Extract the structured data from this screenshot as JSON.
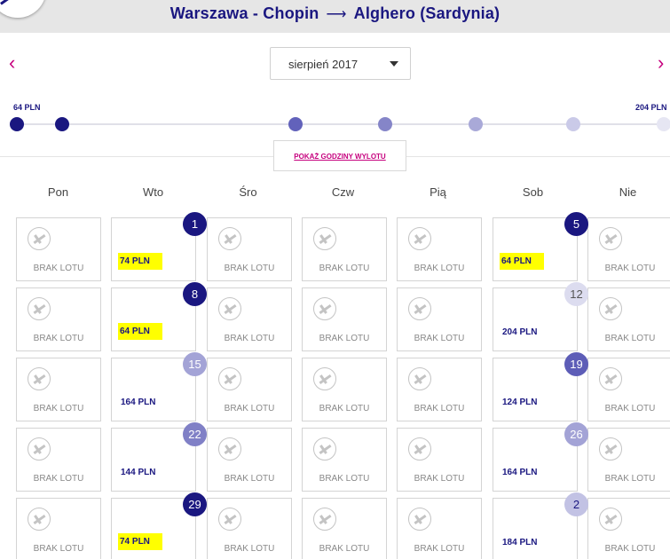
{
  "header": {
    "origin": "Warszawa - Chopin",
    "arrow": "⟶",
    "destination": "Alghero (Sardynia)"
  },
  "nav": {
    "prev": "‹",
    "next": "›"
  },
  "month_select": {
    "value": "sierpień 2017"
  },
  "price_slider": {
    "min_label": "64 PLN",
    "max_label": "204 PLN",
    "dot_colors": [
      "#1a1780",
      "#1a1780",
      "#6262bb",
      "#8585c8",
      "#a9a9d8",
      "#cacae8",
      "#e6e6f3"
    ]
  },
  "show_times_label": "POKAŻ GODZINY WYLOTU",
  "weekdays": [
    "Pon",
    "Wto",
    "Śro",
    "Czw",
    "Pią",
    "Sob",
    "Nie"
  ],
  "no_flight_label": "BRAK LOTU",
  "calendar": [
    [
      {
        "flight": false
      },
      {
        "flight": true,
        "day": "1",
        "price": "74 PLN",
        "highlight": true,
        "badge_color": "#1a1780"
      },
      {
        "flight": false
      },
      {
        "flight": false
      },
      {
        "flight": false
      },
      {
        "flight": true,
        "day": "5",
        "price": "64 PLN",
        "highlight": true,
        "badge_color": "#1a1780"
      },
      {
        "flight": false
      }
    ],
    [
      {
        "flight": false
      },
      {
        "flight": true,
        "day": "8",
        "price": "64 PLN",
        "highlight": true,
        "badge_color": "#1a1780"
      },
      {
        "flight": false
      },
      {
        "flight": false
      },
      {
        "flight": false
      },
      {
        "flight": true,
        "day": "12",
        "price": "204 PLN",
        "highlight": false,
        "badge_color": "#dcdcef",
        "badge_text_color": "#555"
      },
      {
        "flight": false
      }
    ],
    [
      {
        "flight": false
      },
      {
        "flight": true,
        "day": "15",
        "price": "164 PLN",
        "highlight": false,
        "badge_color": "#a3a3d6"
      },
      {
        "flight": false
      },
      {
        "flight": false
      },
      {
        "flight": false
      },
      {
        "flight": true,
        "day": "19",
        "price": "124 PLN",
        "highlight": false,
        "badge_color": "#5d5db7"
      },
      {
        "flight": false
      }
    ],
    [
      {
        "flight": false
      },
      {
        "flight": true,
        "day": "22",
        "price": "144 PLN",
        "highlight": false,
        "badge_color": "#8080c6"
      },
      {
        "flight": false
      },
      {
        "flight": false
      },
      {
        "flight": false
      },
      {
        "flight": true,
        "day": "26",
        "price": "164 PLN",
        "highlight": false,
        "badge_color": "#a3a3d6"
      },
      {
        "flight": false
      }
    ],
    [
      {
        "flight": false
      },
      {
        "flight": true,
        "day": "29",
        "price": "74 PLN",
        "highlight": true,
        "badge_color": "#1a1780"
      },
      {
        "flight": false
      },
      {
        "flight": false
      },
      {
        "flight": false
      },
      {
        "flight": true,
        "day": "2",
        "price": "184 PLN",
        "highlight": false,
        "badge_color": "#c2c2e4",
        "badge_text_color": "#1a1780"
      },
      {
        "flight": false
      }
    ]
  ]
}
